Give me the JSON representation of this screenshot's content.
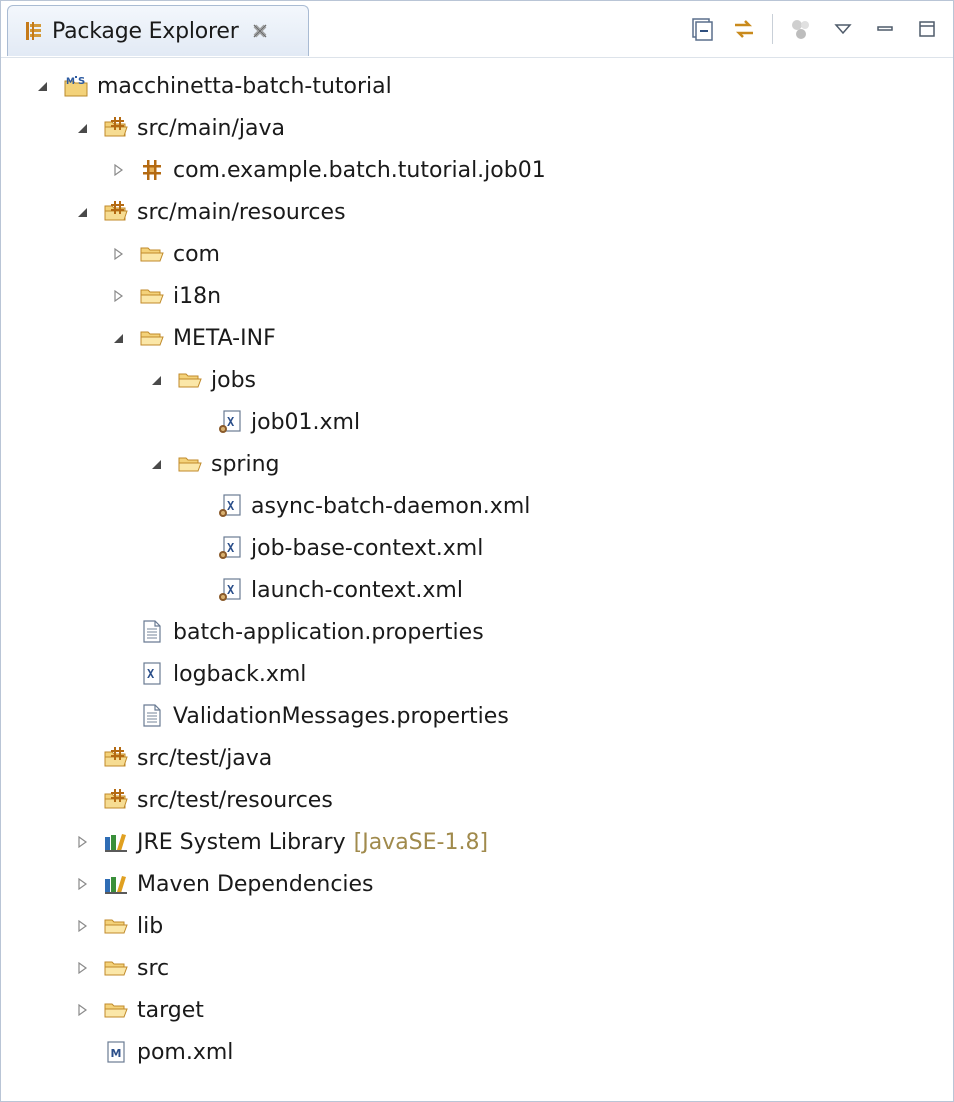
{
  "view": {
    "title": "Package Explorer",
    "toolbar": [
      "collapse-all-icon",
      "link-with-editor-icon",
      "focus-icon",
      "view-menu-icon",
      "minimize-icon",
      "maximize-icon"
    ]
  },
  "tree": [
    {
      "label": "macchinetta-batch-tutorial",
      "icon": "maven-project-icon",
      "twisty": "expanded",
      "level": 0
    },
    {
      "label": "src/main/java",
      "icon": "source-folder-icon",
      "twisty": "expanded",
      "level": 1
    },
    {
      "label": "com.example.batch.tutorial.job01",
      "icon": "package-icon",
      "twisty": "collapsed",
      "level": 2
    },
    {
      "label": "src/main/resources",
      "icon": "source-folder-icon",
      "twisty": "expanded",
      "level": 1
    },
    {
      "label": "com",
      "icon": "folder-icon",
      "twisty": "collapsed",
      "level": 2
    },
    {
      "label": "i18n",
      "icon": "folder-icon",
      "twisty": "collapsed",
      "level": 2
    },
    {
      "label": "META-INF",
      "icon": "folder-icon",
      "twisty": "expanded",
      "level": 2
    },
    {
      "label": "jobs",
      "icon": "folder-icon",
      "twisty": "expanded",
      "level": 3
    },
    {
      "label": "job01.xml",
      "icon": "spring-xml-icon",
      "twisty": "none",
      "level": 4
    },
    {
      "label": "spring",
      "icon": "folder-icon",
      "twisty": "expanded",
      "level": 3
    },
    {
      "label": "async-batch-daemon.xml",
      "icon": "spring-xml-icon",
      "twisty": "none",
      "level": 4
    },
    {
      "label": "job-base-context.xml",
      "icon": "spring-xml-icon",
      "twisty": "none",
      "level": 4
    },
    {
      "label": "launch-context.xml",
      "icon": "spring-xml-icon",
      "twisty": "none",
      "level": 4
    },
    {
      "label": "batch-application.properties",
      "icon": "properties-file-icon",
      "twisty": "none",
      "level": 2
    },
    {
      "label": "logback.xml",
      "icon": "xml-file-icon",
      "twisty": "none",
      "level": 2
    },
    {
      "label": "ValidationMessages.properties",
      "icon": "properties-file-icon",
      "twisty": "none",
      "level": 2
    },
    {
      "label": "src/test/java",
      "icon": "source-folder-icon",
      "twisty": "none",
      "level": 1
    },
    {
      "label": "src/test/resources",
      "icon": "source-folder-icon",
      "twisty": "none",
      "level": 1
    },
    {
      "label": "JRE System Library",
      "suffix": "[JavaSE-1.8]",
      "icon": "library-icon",
      "twisty": "collapsed",
      "level": 1
    },
    {
      "label": "Maven Dependencies",
      "icon": "library-icon",
      "twisty": "collapsed",
      "level": 1
    },
    {
      "label": "lib",
      "icon": "folder-icon",
      "twisty": "collapsed",
      "level": 1
    },
    {
      "label": "src",
      "icon": "folder-icon",
      "twisty": "collapsed",
      "level": 1
    },
    {
      "label": "target",
      "icon": "folder-icon",
      "twisty": "collapsed",
      "level": 1
    },
    {
      "label": "pom.xml",
      "icon": "maven-pom-icon",
      "twisty": "none",
      "level": 1
    }
  ]
}
